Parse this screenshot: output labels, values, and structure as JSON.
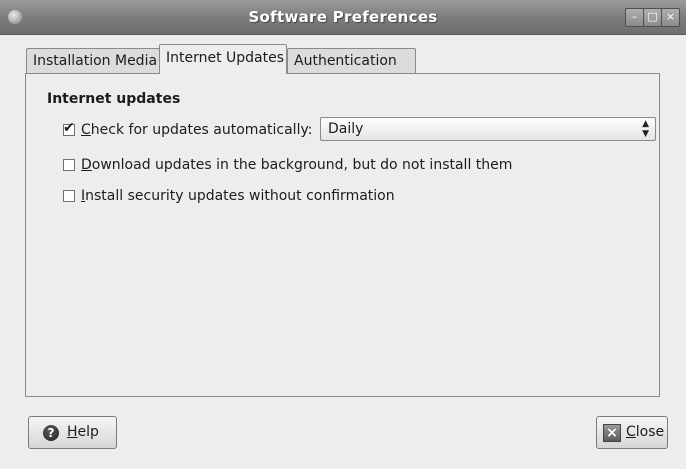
{
  "window": {
    "title": "Software Preferences",
    "controls": {
      "minimize": "–",
      "maximize": "□",
      "close": "×"
    }
  },
  "tabs": [
    {
      "label": "Installation Media",
      "selected": false
    },
    {
      "label": "Internet Updates",
      "selected": true
    },
    {
      "label": "Authentication",
      "selected": false
    }
  ],
  "internet_updates": {
    "section_title": "Internet updates",
    "options": [
      {
        "mnemonic": "C",
        "rest": "heck for updates automatically:",
        "checked": true
      },
      {
        "mnemonic": "D",
        "rest": "ownload updates in the background, but do not install them",
        "checked": false
      },
      {
        "mnemonic": "I",
        "rest": "nstall security updates without confirmation",
        "checked": false
      }
    ],
    "frequency": {
      "selected": "Daily"
    }
  },
  "buttons": {
    "help": {
      "mnemonic": "H",
      "rest": "elp",
      "icon": "help-icon"
    },
    "close": {
      "mnemonic": "C",
      "rest": "lose",
      "icon": "close-icon"
    }
  }
}
